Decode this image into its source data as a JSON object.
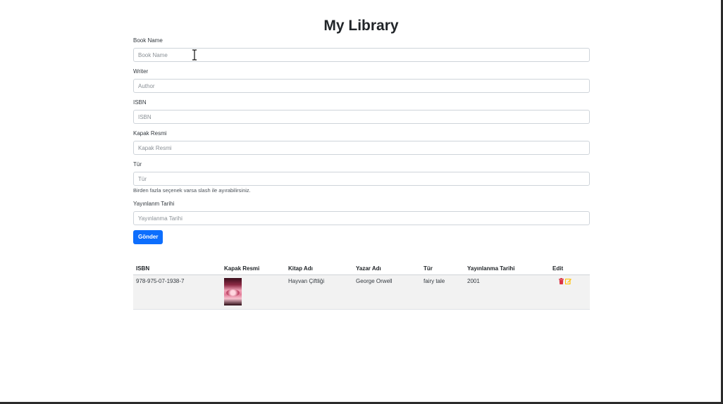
{
  "page": {
    "title": "My Library"
  },
  "form": {
    "book_name": {
      "label": "Book Name",
      "placeholder": "Book Name",
      "value": ""
    },
    "writer": {
      "label": "Writer",
      "placeholder": "Author",
      "value": ""
    },
    "isbn": {
      "label": "ISBN",
      "placeholder": "ISBN",
      "value": ""
    },
    "cover": {
      "label": "Kapak Resmi",
      "placeholder": "Kapak Resmi",
      "value": ""
    },
    "genre": {
      "label": "Tür",
      "placeholder": "Tür",
      "value": "",
      "help": "Birden fazla seçenek varsa slash ile ayırabilirsiniz."
    },
    "publish_date": {
      "label": "Yayınlanm Tarihi",
      "placeholder": "Yayınlanma Tarihi",
      "value": ""
    },
    "submit_label": "Gönder"
  },
  "table": {
    "headers": [
      "ISBN",
      "Kapak Resmi",
      "Kitap Adı",
      "Yazar Adı",
      "Tür",
      "Yayınlanma Tarihi",
      "Edit"
    ],
    "rows": [
      {
        "isbn": "978-975-07-1938-7",
        "cover_icon": "book-cover-image",
        "title": "Hayvan Çiftliği",
        "author": "George Orwell",
        "genre": "fairy tale",
        "year": "2001"
      }
    ]
  },
  "icons": {
    "delete": "trash-icon",
    "edit": "edit-icon"
  },
  "colors": {
    "primary": "#0d6efd",
    "delete": "#dc3545",
    "edit": "#ffc107"
  }
}
